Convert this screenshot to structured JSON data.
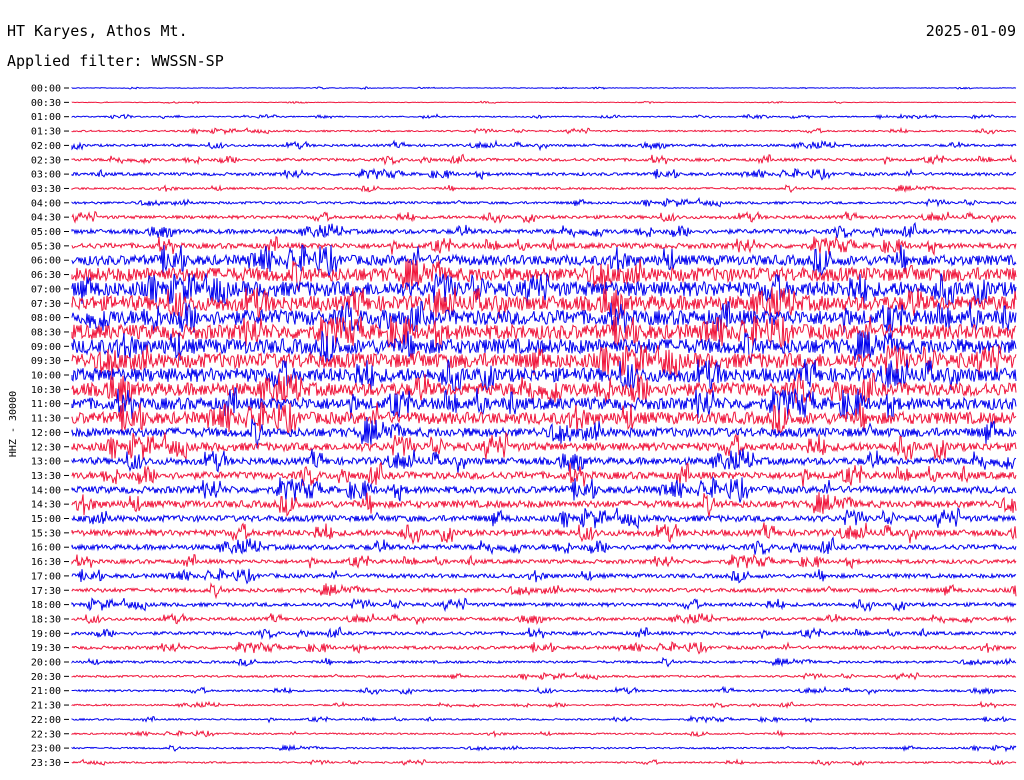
{
  "header": {
    "station": "HT Karyes, Athos Mt.",
    "date": "2025-01-09",
    "filter": "Applied filter: WWSSN-SP"
  },
  "chart_data": {
    "type": "line",
    "title": "HT Karyes, Athos Mt.",
    "channel_label": "HHZ - 30000",
    "y_tick_labels": [
      "00:00",
      "00:30",
      "01:00",
      "01:30",
      "02:00",
      "02:30",
      "03:00",
      "03:30",
      "04:00",
      "04:30",
      "05:00",
      "05:30",
      "06:00",
      "06:30",
      "07:00",
      "07:30",
      "08:00",
      "08:30",
      "09:00",
      "09:30",
      "10:00",
      "10:30",
      "11:00",
      "11:30",
      "12:00",
      "12:30",
      "13:00",
      "13:30",
      "14:00",
      "14:30",
      "15:00",
      "15:30",
      "16:00",
      "16:30",
      "17:00",
      "17:30",
      "18:00",
      "18:30",
      "19:00",
      "19:30",
      "20:00",
      "20:30",
      "21:00",
      "21:30",
      "22:00",
      "22:30",
      "23:00",
      "23:30"
    ],
    "series_colors": [
      "#0000ee",
      "#f0163c"
    ],
    "trace_amplitude": [
      0.3,
      0.3,
      0.6,
      0.8,
      1.2,
      1.4,
      1.5,
      1.0,
      1.2,
      1.6,
      2.2,
      2.6,
      5.0,
      7.0,
      7.5,
      7.5,
      7.5,
      7.5,
      7.5,
      7.5,
      7.0,
      6.5,
      6.0,
      6.0,
      4.5,
      4.0,
      3.5,
      3.5,
      3.5,
      3.5,
      3.0,
      3.0,
      2.5,
      2.0,
      2.0,
      2.0,
      1.8,
      1.6,
      1.6,
      1.6,
      1.2,
      1.0,
      1.0,
      0.8,
      0.8,
      0.8,
      0.8,
      0.8
    ],
    "grid": false
  }
}
